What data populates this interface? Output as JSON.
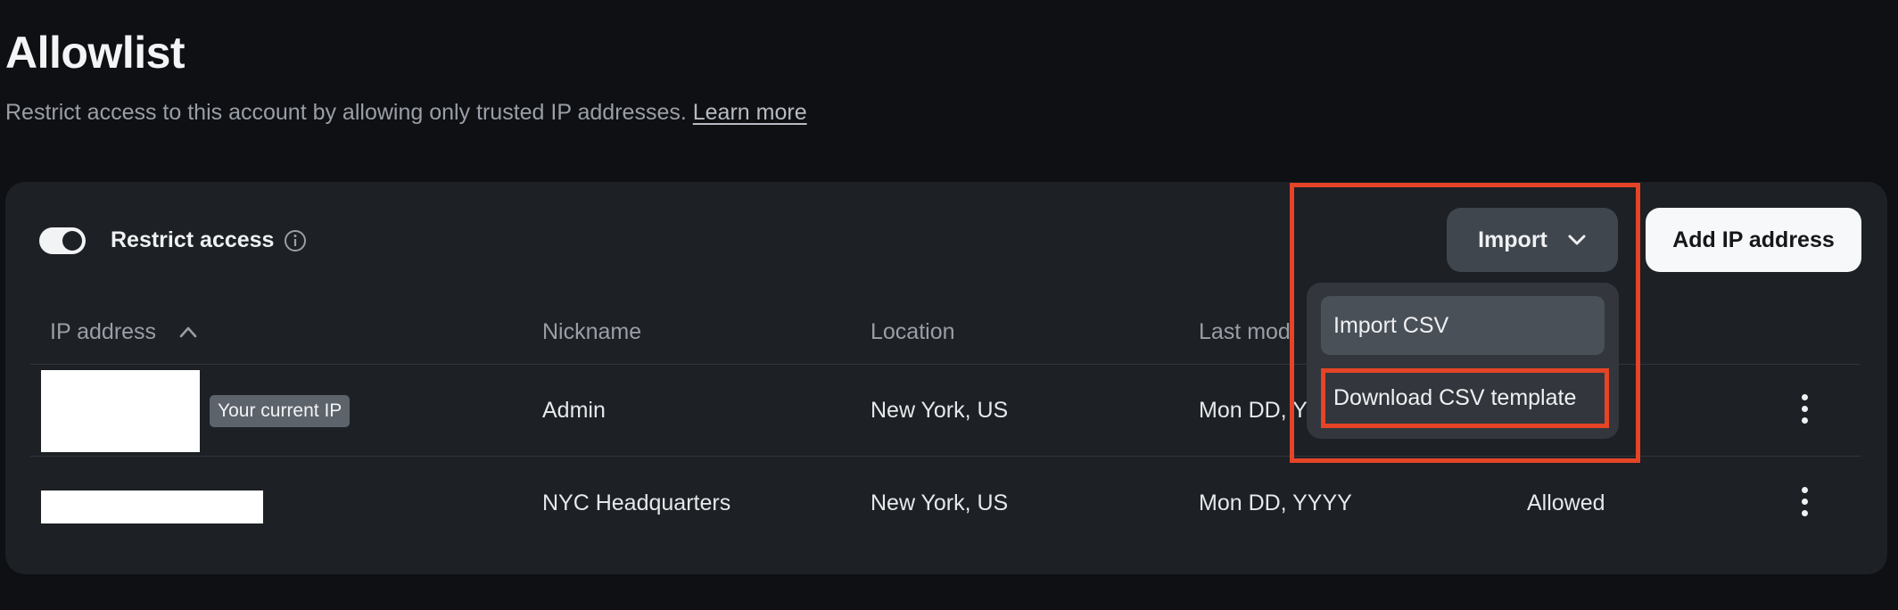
{
  "page": {
    "title": "Allowlist",
    "description": "Restrict access to this account by allowing only trusted IP addresses.",
    "learn_more": "Learn more"
  },
  "toolbar": {
    "restrict_access_label": "Restrict access",
    "restrict_access_on": true,
    "import_label": "Import",
    "add_ip_label": "Add IP address"
  },
  "import_menu": {
    "items": [
      "Import CSV",
      "Download CSV template"
    ]
  },
  "table": {
    "columns": [
      "IP address",
      "Nickname",
      "Location",
      "Last modi"
    ],
    "rows": [
      {
        "badge": "Your current IP",
        "nickname": "Admin",
        "location": "New York, US",
        "last_modified": "Mon DD, Y",
        "status": ""
      },
      {
        "badge": "",
        "nickname": "NYC Headquarters",
        "location": "New York, US",
        "last_modified": "Mon DD, YYYY",
        "status": "Allowed"
      }
    ]
  },
  "colors": {
    "background": "#0e1013",
    "card": "#1d2024",
    "annotation_highlight": "#e54427"
  }
}
